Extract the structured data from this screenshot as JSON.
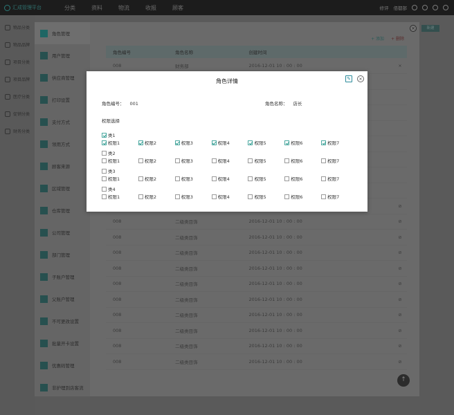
{
  "topbar": {
    "logo_text": "汇成管理平台",
    "nav": [
      "分类",
      "资料",
      "物流",
      "收报",
      "顾客"
    ],
    "right_links": [
      "修评",
      "佰都部"
    ]
  },
  "main_sidebar": [
    "物品分类",
    "物品品牌",
    "项目分类",
    "项目品牌",
    "医疗分类",
    "促销分类",
    "财务分类"
  ],
  "sub_sidebar": [
    "角色管理",
    "用户管理",
    "供应商管理",
    "打印设置",
    "支付方式",
    "领用方式",
    "顾客来源",
    "区域管理",
    "仓库管理",
    "公司管理",
    "部门管理",
    "子账户管理",
    "父账户管理",
    "不可更改设置",
    "批量开卡设置",
    "优惠码管理",
    "非护理到店客流"
  ],
  "background": {
    "actions": {
      "add": "添加",
      "del": "删除"
    },
    "table_headers": [
      "角色编号",
      "角色名称",
      "创建时间"
    ],
    "rows": [
      {
        "id": "008",
        "name": "财务部",
        "time": "2016-12-01  10 : 00 : 00",
        "mark": "×"
      },
      {
        "id": "",
        "name": "",
        "time": "",
        "mark": ""
      },
      {
        "id": "",
        "name": "",
        "time": "",
        "mark": ""
      },
      {
        "id": "",
        "name": "",
        "time": "",
        "mark": ""
      },
      {
        "id": "",
        "name": "",
        "time": "",
        "mark": ""
      },
      {
        "id": "",
        "name": "",
        "time": "",
        "mark": ""
      },
      {
        "id": "",
        "name": "",
        "time": "",
        "mark": ""
      },
      {
        "id": "",
        "name": "",
        "time": "",
        "mark": ""
      },
      {
        "id": "",
        "name": "",
        "time": "",
        "mark": ""
      },
      {
        "id": "008",
        "name": "二级类目饰",
        "time": "2016-12-01  10 : 00 : 00",
        "mark": "⊘"
      },
      {
        "id": "008",
        "name": "二级类目饰",
        "time": "2016-12-01  10 : 00 : 00",
        "mark": "⊘"
      },
      {
        "id": "008",
        "name": "二级类目饰",
        "time": "2016-12-01  10 : 00 : 00",
        "mark": "⊘"
      },
      {
        "id": "008",
        "name": "二级类目饰",
        "time": "2016-12-01  10 : 00 : 00",
        "mark": "⊘"
      },
      {
        "id": "008",
        "name": "二级类目饰",
        "time": "2016-12-01  10 : 00 : 00",
        "mark": "⊘"
      },
      {
        "id": "008",
        "name": "二级类目饰",
        "time": "2016-12-01  10 : 00 : 00",
        "mark": "⊘"
      },
      {
        "id": "008",
        "name": "二级类目饰",
        "time": "2016-12-01  10 : 00 : 00",
        "mark": "⊘"
      },
      {
        "id": "008",
        "name": "二级类目饰",
        "time": "2016-12-01  10 : 00 : 00",
        "mark": "⊘"
      },
      {
        "id": "008",
        "name": "二级类目饰",
        "time": "2016-12-01  10 : 00 : 00",
        "mark": "⊘"
      },
      {
        "id": "008",
        "name": "二级类目饰",
        "time": "2016-12-01  10 : 00 : 00",
        "mark": "⊘"
      },
      {
        "id": "008",
        "name": "二级类目饰",
        "time": "2016-12-01  10 : 00 : 00",
        "mark": "⊘"
      }
    ],
    "right_button": "新建"
  },
  "modal": {
    "title": "角色详情",
    "role_id_label": "角色编号：",
    "role_id_value": "001",
    "role_name_label": "角色名称：",
    "role_name_value": "店长",
    "perm_label": "权限选择",
    "categories": [
      {
        "name": "类1",
        "checked": true,
        "perms": [
          {
            "label": "权限1",
            "checked": true
          },
          {
            "label": "权限2",
            "checked": true
          },
          {
            "label": "权限3",
            "checked": true
          },
          {
            "label": "权限4",
            "checked": true
          },
          {
            "label": "权限5",
            "checked": true
          },
          {
            "label": "权限6",
            "checked": true
          },
          {
            "label": "权限7",
            "checked": true
          }
        ]
      },
      {
        "name": "类2",
        "checked": false,
        "perms": [
          {
            "label": "权限1",
            "checked": false
          },
          {
            "label": "权限2",
            "checked": false
          },
          {
            "label": "权限3",
            "checked": false
          },
          {
            "label": "权限4",
            "checked": false
          },
          {
            "label": "权限5",
            "checked": false
          },
          {
            "label": "权限6",
            "checked": false
          },
          {
            "label": "权限7",
            "checked": false
          }
        ]
      },
      {
        "name": "类3",
        "checked": false,
        "perms": [
          {
            "label": "权限1",
            "checked": false
          },
          {
            "label": "权限2",
            "checked": false
          },
          {
            "label": "权限3",
            "checked": false
          },
          {
            "label": "权限4",
            "checked": false
          },
          {
            "label": "权限5",
            "checked": false
          },
          {
            "label": "权限6",
            "checked": false
          },
          {
            "label": "权限7",
            "checked": false
          }
        ]
      },
      {
        "name": "类4",
        "checked": false,
        "perms": [
          {
            "label": "权限1",
            "checked": false
          },
          {
            "label": "权限2",
            "checked": false
          },
          {
            "label": "权限3",
            "checked": false
          },
          {
            "label": "权限4",
            "checked": false
          },
          {
            "label": "权限5",
            "checked": false
          },
          {
            "label": "权限6",
            "checked": false
          },
          {
            "label": "权限7",
            "checked": false
          }
        ]
      }
    ]
  },
  "colors": {
    "accent": "#2f9a8e",
    "topbar": "#1c1c1c",
    "overlay": "#5a5a5a"
  }
}
